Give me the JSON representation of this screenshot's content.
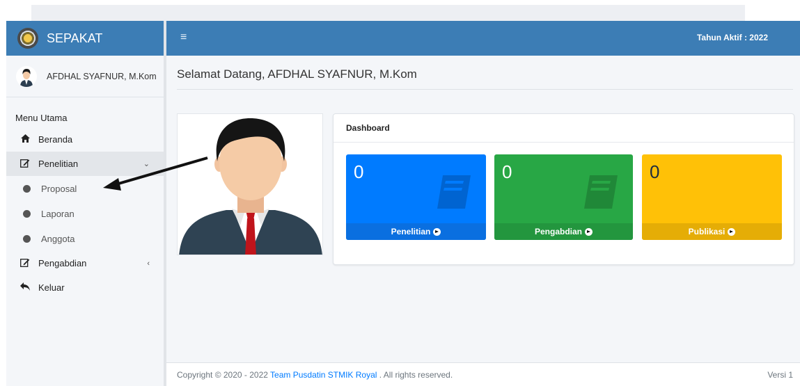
{
  "app": {
    "brand": "SEPAKAT",
    "tahun_aktif": "Tahun Aktif : 2022"
  },
  "user": {
    "name": "AFDHAL SYAFNUR, M.Kom"
  },
  "sidebar": {
    "menu_title": "Menu Utama",
    "items": [
      {
        "label": "Beranda",
        "icon": "home-icon"
      },
      {
        "label": "Penelitian",
        "icon": "edit-icon",
        "caret": "⌄"
      },
      {
        "label": "Proposal",
        "icon": "circle-icon"
      },
      {
        "label": "Laporan",
        "icon": "circle-icon"
      },
      {
        "label": "Anggota",
        "icon": "circle-icon"
      },
      {
        "label": "Pengabdian",
        "icon": "edit-icon",
        "caret": "‹"
      },
      {
        "label": "Keluar",
        "icon": "reply-icon"
      }
    ]
  },
  "main": {
    "welcome": "Selamat Datang, AFDHAL SYAFNUR, M.Kom",
    "dashboard_title": "Dashboard",
    "boxes": [
      {
        "value": "0",
        "label": "Penelitian",
        "color": "#007bff"
      },
      {
        "value": "0",
        "label": "Pengabdian",
        "color": "#28a745"
      },
      {
        "value": "0",
        "label": "Publikasi",
        "color": "#ffc107"
      }
    ]
  },
  "footer": {
    "copyright_prefix": "Copyright © 2020 - 2022",
    "team_link": "Team Pusdatin STMIK Royal",
    "rights": ". All rights reserved.",
    "versi": "Versi 1"
  }
}
